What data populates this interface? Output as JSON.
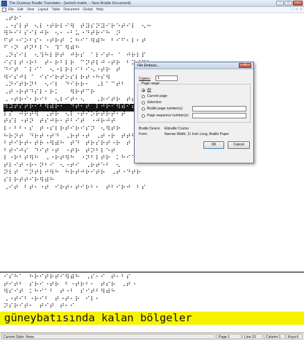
{
  "window": {
    "title": "The Duxbury Braille Translator - [turkish-trable -- New Braille Document]",
    "minimize": "–",
    "maximize": "□",
    "close": "×"
  },
  "menu": [
    "File",
    "Edit",
    "View",
    "Layout",
    "Table",
    "Document",
    "Global",
    "Help"
  ],
  "mdi_controls": [
    "–",
    "□",
    "×"
  ],
  "braille_top": [
    "⠠⠞⠗⠁⠀",
    "⠠⠐⠎⠇⠞⠀⠢⠇⠐⠞⠗⠇⠊⠻⠀⠞⠽⠎⠝⠽⠊⠗⠑⠞⠊⠇⠀⠢⠒",
    "⠻⠓⠊⠃⠎⠊⠇⠚⠗⠀⠢⠂⠐⠃⠥⠐⠙⠞⠗⠊⠓⠀⠝",
    "⠋⠞⠐⠊⠕⠃⠎⠂⠐⠞⠗⠞⠀⠅⠓⠊⠁⠻⠾⠓⠀⠃⠊⠋⠂⠇⠂⠞",
    "⠋⠐⠝⠀⠞⠝⠃⠇⠑⠀⠹⠁⠻⠾⠓",
    "⠠⠝⠎⠊⠇⠀⠢⠹⠓⠇⠟⠞⠀⠚⠗⠎⠀⠁⠇⠊⠞⠂⠈⠀⠚⠗⠇⠏",
    "⠊⠎⠇⠞⠐⠗⠃⠀⠞⠂⠗⠃⠇⠗⠀⠉⠝⠞⠇⠚⠐⠞⠗⠀⠃⠽⠞⠻⠓",
    "⠙⠊⠞⠀⠁⠇⠊⠁⠀⠢⠐⠇⠗⠇⠊⠃⠊⠢⠐⠞⠗⠀⠞",
    "⠻⠊⠎⠚⠇⠈⠀⠊⠎⠊⠗⠞⠕⠎⠇⠗⠞⠐⠓⠎⠻",
    "⠠⠝⠊⠞⠗⠝⠃⠀⠢⠊⠇⠀⠙⠊⠗⠗⠂⠀⠠⠇⠁⠉⠞⠃",
    "⠠⠞⠐⠗⠞⠙⠎⠇⠂⠗⠅⠀⠀⠻⠗⠞⠉⠗",
    "⠠⠐⠞⠗⠊⠂⠗⠊⠃⠀⠢⠇⠊⠞⠂⠢⠀⠀⠠⠗⠊⠞⠗⠀⠞⠞⠉⠞",
    "⠻⠽⠞⠎⠞⠗⠊⠃⠻⠾⠗⠂⠀⠙⠞⠂⠞⠀⠇⠚⠗⠊⠻⠾⠊⠞⠚⠓",
    "⠇⠎⠀⠚⠗⠞⠻⠀⠠⠞⠗⠀⠢⠇⠐⠞⠊⠕⠗⠞⠗⠞⠂⠞",
    "⠞⠎⠇⠐⠞⠝⠀⠞⠎⠚⠗⠂⠞⠃⠊⠞⠀⠐⠚⠗⠚⠞",
    "⠇⠂⠃⠃⠂⠎⠀⠞⠐⠎⠇⠗⠞⠊⠗⠊⠎⠝⠀⠢⠻⠞⠗",
    "⠓⠗⠝⠞⠀⠙⠗⠞⠐⠞⠙⠀⠠⠗⠞⠐⠞⠀⠠⠞⠐⠗⠀⠞⠞⠃",
    "⠃⠞⠊⠗⠞⠂⠞⠗⠐⠻⠾⠓⠀⠞⠙⠀⠞⠗⠎⠗⠞⠐⠗⠀⠞⠐",
    "⠃⠞⠊⠚⠎⠀⠙⠊⠞⠐⠞⠀⠐⠞⠗⠀⠞⠝⠃⠇⠑⠞",
    "⠇⠐⠗⠃⠞⠻⠓⠀⠠⠐⠗⠞⠻⠓⠀⠐⠝⠃⠇⠞⠗⠀⠅⠓⠊⠁⠻⠾⠓",
    "⠞⠇⠊⠞⠐⠗⠂⠝⠃⠊⠀⠢⠐⠞⠊⠀⠠⠗⠞⠑⠃⠀⠢",
    "⠝⠇⠞⠀⠉⠝⠞⠇⠚⠻⠓⠀⠓⠗⠞⠚⠗⠊⠞⠗⠀⠠⠞⠐⠙⠞⠗",
    "⠎⠇⠗⠞⠞⠊⠗⠻⠾⠓",
    "⠠⠊⠞⠀⠃⠞⠂⠐⠞⠀⠊⠗⠞⠂⠞⠊⠗⠃⠂⠀⠞⠃⠊⠗⠚⠀⠃⠎"
  ],
  "braille_bottom": [
    "⠊⠎⠓⠁⠀⠓⠗⠊⠞⠗⠞⠊⠻⠾⠓⠀⠠⠎⠂⠊⠀⠞⠂⠃⠎",
    "⠞⠊⠞⠃⠀⠎⠗⠊⠐⠞⠗⠀⠃⠐⠞⠗⠃⠂⠀⠞⠎⠗⠀⠠⠞⠐",
    "⠻⠎⠊⠞⠀⠅⠓⠊⠁⠃⠀⠞⠐⠃⠀⠎⠊⠞⠃⠻⠾⠓",
    "⠠⠐⠞⠊⠃⠐⠗⠊⠃⠀⠞⠐⠞⠂⠗⠀⠊⠇⠂",
    "⠝⠎⠗⠊⠞⠂⠀⠞⠊⠞⠀⠞⠂⠊"
  ],
  "print_line": "güneybatısında kalan bölgeler",
  "status": {
    "style": "Current Style: None",
    "page": "Page:1",
    "line": "Line:13",
    "column": "Column:1",
    "keys": "Keys:6"
  },
  "dialog": {
    "title": "File Emboss...",
    "copies_label": "Copies:",
    "copies_value": "1",
    "page_range_label": "Page range",
    "options": [
      "All",
      "Current page",
      "Selection",
      "Braille page number(s):",
      "Page sequence number(s):"
    ],
    "selected_index": 0,
    "device_label": "Braille Device",
    "device_value": "Elbraille Cosmo",
    "form_label": "Form",
    "form_value": "Narrow Width, 11 Inch Long, Braille Paper",
    "ok": "OK",
    "cancel": "Cancel"
  }
}
